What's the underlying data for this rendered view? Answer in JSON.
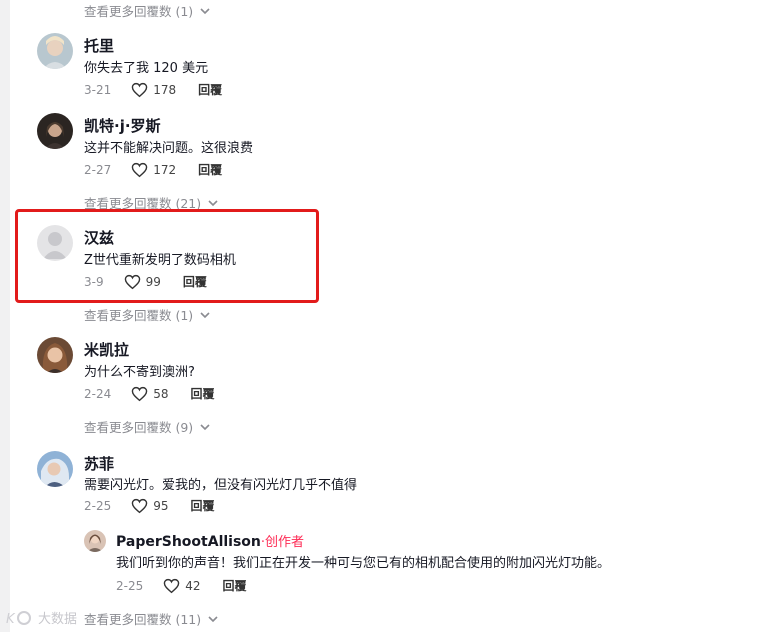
{
  "see_more_1": "查看更多回覆数 (1)",
  "see_more_2": "查看更多回覆数 (21)",
  "see_more_3": "查看更多回覆数 (1)",
  "see_more_4": "查看更多回覆数 (9)",
  "see_more_5": "查看更多回覆数 (11)",
  "comments": [
    {
      "name": "托里",
      "text": "你失去了我 120 美元",
      "date": "3-21",
      "likes": "178",
      "reply": "回覆"
    },
    {
      "name": "凯特·j·罗斯",
      "text": "这并不能解决问题。这很浪费",
      "date": "2-27",
      "likes": "172",
      "reply": "回覆"
    },
    {
      "name": "汉兹",
      "text": "Z世代重新发明了数码相机",
      "date": "3-9",
      "likes": "99",
      "reply": "回覆"
    },
    {
      "name": "米凯拉",
      "text": "为什么不寄到澳洲?",
      "date": "2-24",
      "likes": "58",
      "reply": "回覆"
    },
    {
      "name": "苏菲",
      "text": "需要闪光灯。爱我的，但没有闪光灯几乎不值得",
      "date": "2-25",
      "likes": "95",
      "reply": "回覆"
    }
  ],
  "creator_reply": {
    "name": "PaperShootAllison",
    "badge": "·创作者",
    "text": "我们听到你的声音！我们正在开发一种可与您已有的相机配合使用的附加闪光灯功能。",
    "date": "2-25",
    "likes": "42",
    "reply": "回覆"
  },
  "watermark": "大数据",
  "colors": {
    "highlight": "#e21b1b",
    "creator_badge": "#fe2c55",
    "muted_text": "#8a8b91"
  }
}
